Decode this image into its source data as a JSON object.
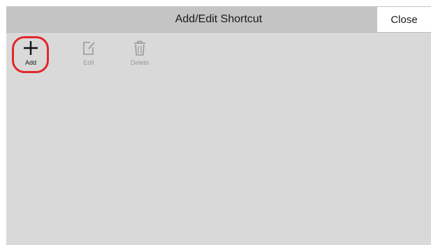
{
  "header": {
    "title": "Add/Edit Shortcut",
    "close_label": "Close"
  },
  "toolbar": {
    "add_label": "Add",
    "edit_label": "Edit",
    "delete_label": "Delete",
    "add_icon": "plus-icon",
    "edit_icon": "edit-icon",
    "delete_icon": "trash-icon"
  },
  "colors": {
    "panel_background": "#d9d9d9",
    "header_background": "#c4c4c4",
    "highlight": "#e3262b",
    "disabled": "#9a9a9a"
  }
}
